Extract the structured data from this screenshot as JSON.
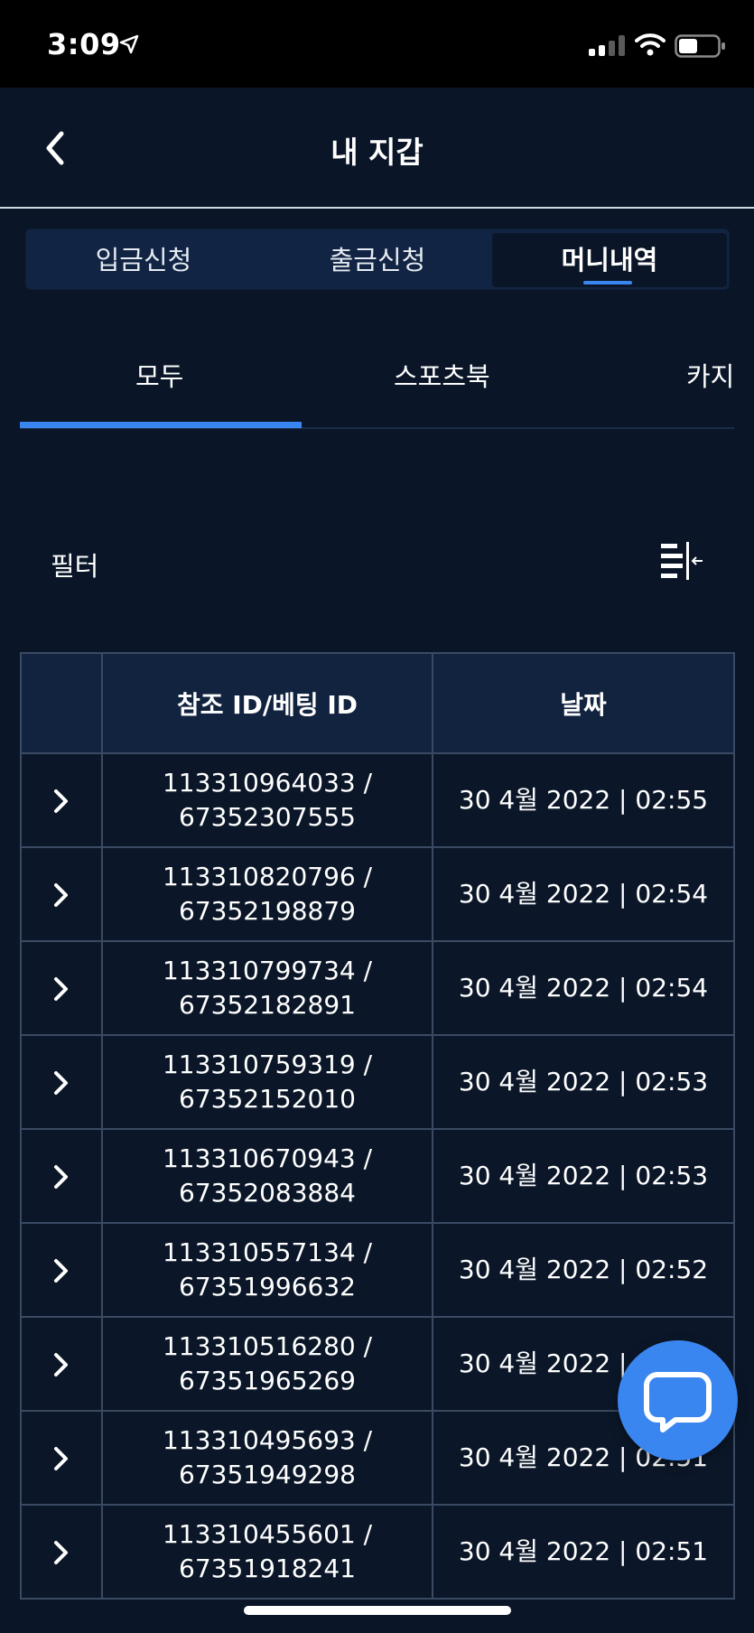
{
  "status_bar": {
    "time": "3:09"
  },
  "header": {
    "title": "내 지갑"
  },
  "segments": [
    {
      "label": "입금신청"
    },
    {
      "label": "출금신청"
    },
    {
      "label": "머니내역"
    }
  ],
  "active_segment": "머니내역",
  "subtabs": [
    {
      "label": "모두"
    },
    {
      "label": "스포츠북"
    },
    {
      "label": "카지"
    }
  ],
  "active_subtab": "모두",
  "filter": {
    "label": "필터"
  },
  "table": {
    "headers": {
      "expand": "",
      "ref": "참조 ID/베팅 ID",
      "date": "날짜"
    },
    "rows": [
      {
        "ref_line1": "113310964033 /",
        "ref_line2": "67352307555",
        "date": "30 4월 2022 | 02:55"
      },
      {
        "ref_line1": "113310820796 /",
        "ref_line2": "67352198879",
        "date": "30 4월 2022 | 02:54"
      },
      {
        "ref_line1": "113310799734 /",
        "ref_line2": "67352182891",
        "date": "30 4월 2022 | 02:54"
      },
      {
        "ref_line1": "113310759319 /",
        "ref_line2": "67352152010",
        "date": "30 4월 2022 | 02:53"
      },
      {
        "ref_line1": "113310670943 /",
        "ref_line2": "67352083884",
        "date": "30 4월 2022 | 02:53"
      },
      {
        "ref_line1": "113310557134 /",
        "ref_line2": "67351996632",
        "date": "30 4월 2022 | 02:52"
      },
      {
        "ref_line1": "113310516280 /",
        "ref_line2": "67351965269",
        "date": "30 4월 2022 | 02:52"
      },
      {
        "ref_line1": "113310495693 /",
        "ref_line2": "67351949298",
        "date": "30 4월 2022 | 02:51"
      },
      {
        "ref_line1": "113310455601 /",
        "ref_line2": "67351918241",
        "date": "30 4월 2022 | 02:51"
      }
    ]
  },
  "colors": {
    "background": "#0a1628",
    "accent": "#3a86f0",
    "header_row": "#12233f"
  },
  "icons": [
    "back-chevron-icon",
    "location-arrow-icon",
    "signal-icon",
    "wifi-icon",
    "battery-icon",
    "filter-icon",
    "chevron-right-icon",
    "chat-icon"
  ]
}
